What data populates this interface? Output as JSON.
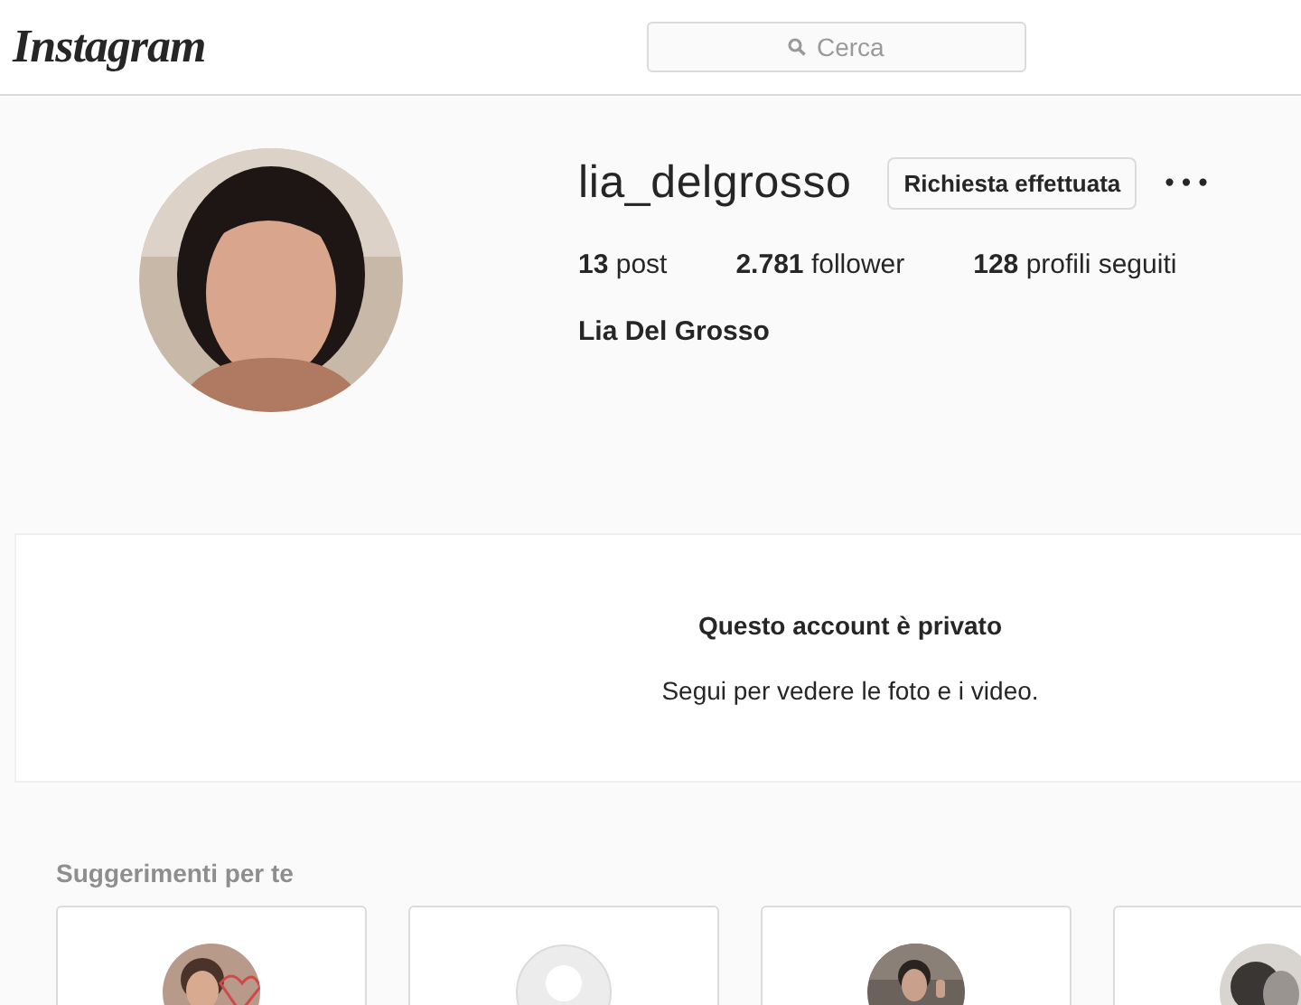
{
  "header": {
    "logo": "Instagram",
    "search": {
      "placeholder": "Cerca"
    }
  },
  "profile": {
    "avatar": {
      "kind": "picture"
    },
    "username": "lia_delgrosso",
    "request_button": "Richiesta effettuata",
    "more": "•••",
    "stats": [
      {
        "count": "13",
        "label": "post"
      },
      {
        "count": "2.781",
        "label": "follower"
      },
      {
        "count": "128",
        "label": "profili seguiti"
      }
    ],
    "full_name": "Lia Del Grosso"
  },
  "private_notice": {
    "title": "Questo account è privato",
    "text": "Segui per vedere le foto e i video."
  },
  "suggestions": {
    "title": "Suggerimenti per te",
    "cards": [
      {
        "kind": "picture"
      },
      {
        "kind": "placeholder"
      },
      {
        "kind": "picture"
      },
      {
        "kind": "picture"
      }
    ]
  }
}
